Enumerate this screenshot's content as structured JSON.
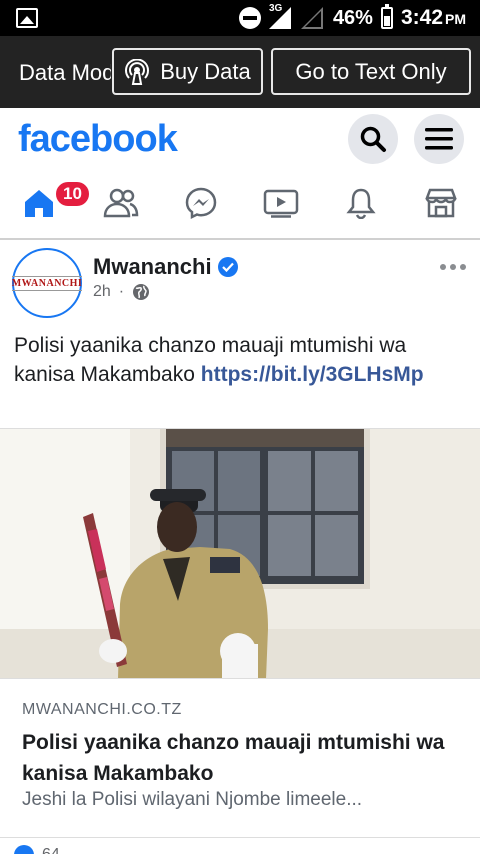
{
  "status_bar": {
    "network": "3G",
    "battery": "46%",
    "time": "3:42",
    "ampm": "PM"
  },
  "data_bar": {
    "mode_label": "Data Mode",
    "buy_data": "Buy Data",
    "text_only": "Go to Text Only"
  },
  "header": {
    "logo": "facebook",
    "notification_count": "10"
  },
  "post": {
    "avatar_text": "MWANANCHI",
    "author": "Mwananchi",
    "time": "2h",
    "separator": "·",
    "text": "Polisi yaanika chanzo mauaji mtumishi wa kanisa Makambako",
    "link": "https://bit.ly/3GLHsMp",
    "link_card": {
      "domain": "MWANANCHI.CO.TZ",
      "title": "Polisi yaanika chanzo mauaji mtumishi wa kanisa Makambako",
      "description": "Jeshi la Polisi wilayani Njombe limeele..."
    },
    "reaction_count": "64"
  },
  "colors": {
    "brand": "#1877f2",
    "badge": "#e41e3f",
    "link": "#385898"
  }
}
